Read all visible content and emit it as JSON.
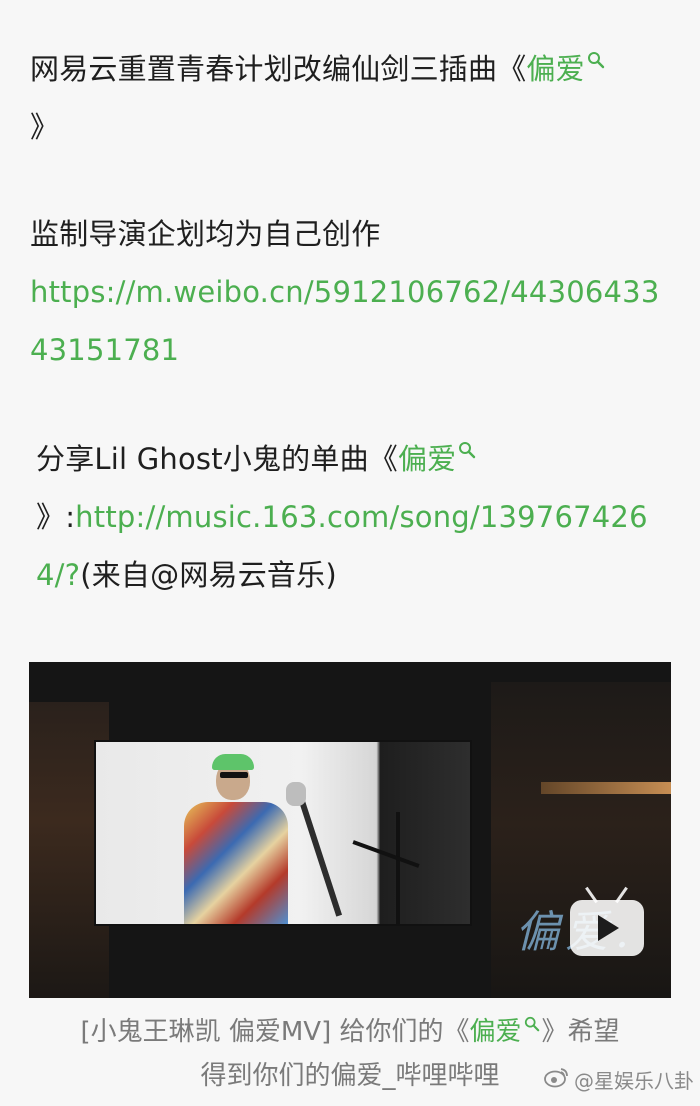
{
  "post": {
    "line1": {
      "text": "网易云重置青春计划改编仙剑三插曲《",
      "topic": "偏爱",
      "close": "》"
    },
    "line2": {
      "text": "监制导演企划均为自己创作",
      "url": "https://m.weibo.cn/5912106762/4430643343151781"
    },
    "line3": {
      "lead": "分享Lil Ghost小鬼的单曲《",
      "topic": "偏爱",
      "mid": "》:",
      "url": "http://music.163.com/song/1397674264/?",
      "tail": "(来自@网易云音乐)"
    }
  },
  "video": {
    "overlay_text": "偏爱.",
    "play_icon": "tv-play-icon"
  },
  "caption": {
    "prefix": "[小鬼王琳凯 偏爱MV] 给你们的《",
    "topic": "偏爱",
    "suffix_a": "》希望",
    "line2": "得到你们的偏爱_哔哩哔哩"
  },
  "watermark": {
    "text": "@星娱乐八卦"
  },
  "colors": {
    "link": "#4caf50",
    "caption": "#7a7a7a",
    "text": "#1f1f1f"
  },
  "icons": {
    "topic_search": "magnifier-icon",
    "weibo_logo": "weibo-logo-icon"
  }
}
